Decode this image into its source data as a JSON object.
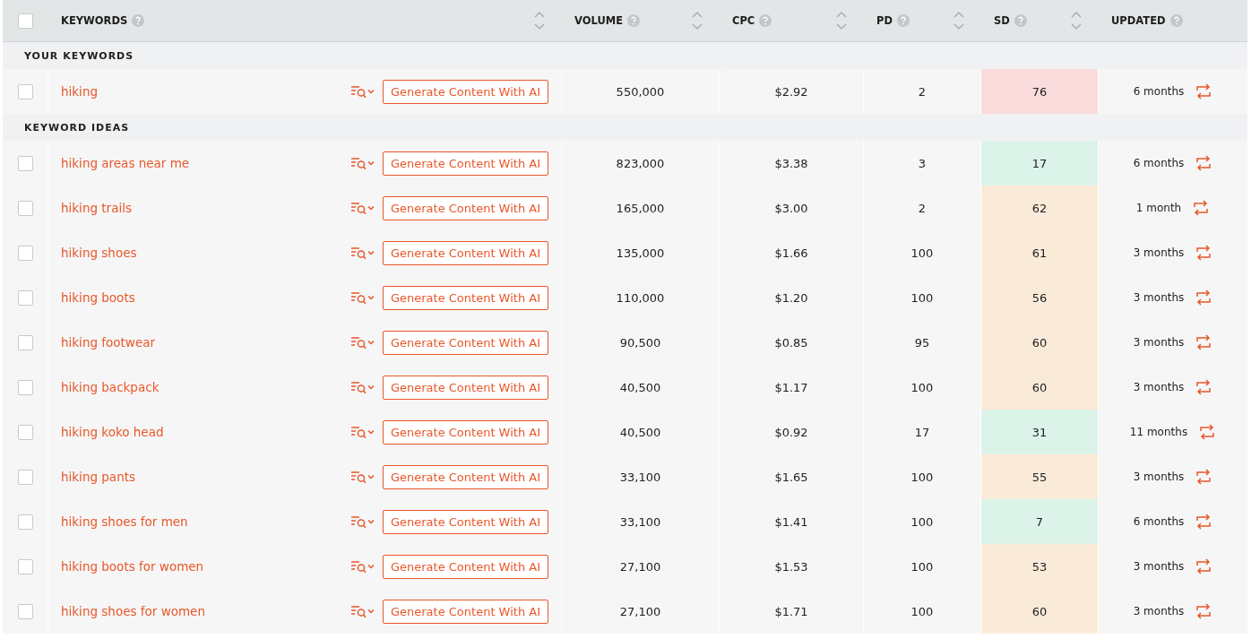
{
  "table": {
    "select_all": {
      "checked": false
    },
    "columns": [
      {
        "label": "KEYWORDS",
        "sortable": true
      },
      {
        "label": "VOLUME",
        "sortable": true
      },
      {
        "label": "CPC",
        "sortable": true
      },
      {
        "label": "PD",
        "sortable": true
      },
      {
        "label": "SD",
        "sortable": true
      },
      {
        "label": "UPDATED",
        "sortable": false
      }
    ],
    "sections": [
      {
        "title": "YOUR KEYWORDS",
        "rows": [
          {
            "checked": false,
            "keyword": "hiking",
            "action": "Generate Content With AI",
            "volume": "550,000",
            "cpc": "$2.92",
            "pd": "2",
            "sd": "76",
            "color": "#fadcdc",
            "updated": "6 months"
          }
        ]
      },
      {
        "title": "KEYWORD IDEAS",
        "rows": [
          {
            "checked": false,
            "keyword": "hiking areas near me",
            "action": "Generate Content With AI",
            "volume": "823,000",
            "cpc": "$3.38",
            "pd": "3",
            "sd": "17",
            "color": "#dcf3ea",
            "updated": "6 months"
          },
          {
            "checked": false,
            "keyword": "hiking trails",
            "action": "Generate Content With AI",
            "volume": "165,000",
            "cpc": "$3.00",
            "pd": "2",
            "sd": "62",
            "color": "#faebd9",
            "updated": "1 month"
          },
          {
            "checked": false,
            "keyword": "hiking shoes",
            "action": "Generate Content With AI",
            "volume": "135,000",
            "cpc": "$1.66",
            "pd": "100",
            "sd": "61",
            "color": "#faebd9",
            "updated": "3 months"
          },
          {
            "checked": false,
            "keyword": "hiking boots",
            "action": "Generate Content With AI",
            "volume": "110,000",
            "cpc": "$1.20",
            "pd": "100",
            "sd": "56",
            "color": "#faebd9",
            "updated": "3 months"
          },
          {
            "checked": false,
            "keyword": "hiking footwear",
            "action": "Generate Content With AI",
            "volume": "90,500",
            "cpc": "$0.85",
            "pd": "95",
            "sd": "60",
            "color": "#faebd9",
            "updated": "3 months"
          },
          {
            "checked": false,
            "keyword": "hiking backpack",
            "action": "Generate Content With AI",
            "volume": "40,500",
            "cpc": "$1.17",
            "pd": "100",
            "sd": "60",
            "color": "#faebd9",
            "updated": "3 months"
          },
          {
            "checked": false,
            "keyword": "hiking koko head",
            "action": "Generate Content With AI",
            "volume": "40,500",
            "cpc": "$0.92",
            "pd": "17",
            "sd": "31",
            "color": "#dcf3ea",
            "updated": "11 months"
          },
          {
            "checked": false,
            "keyword": "hiking pants",
            "action": "Generate Content With AI",
            "volume": "33,100",
            "cpc": "$1.65",
            "pd": "100",
            "sd": "55",
            "color": "#faebd9",
            "updated": "3 months"
          },
          {
            "checked": false,
            "keyword": "hiking shoes for men",
            "action": "Generate Content With AI",
            "volume": "33,100",
            "cpc": "$1.41",
            "pd": "100",
            "sd": "7",
            "color": "#dcf3ea",
            "updated": "6 months"
          },
          {
            "checked": false,
            "keyword": "hiking boots for women",
            "action": "Generate Content With AI",
            "volume": "27,100",
            "cpc": "$1.53",
            "pd": "100",
            "sd": "53",
            "color": "#faebd9",
            "updated": "3 months"
          },
          {
            "checked": false,
            "keyword": "hiking shoes for women",
            "action": "Generate Content With AI",
            "volume": "27,100",
            "cpc": "$1.71",
            "pd": "100",
            "sd": "60",
            "color": "#faebd9",
            "updated": "3 months"
          }
        ]
      }
    ]
  }
}
